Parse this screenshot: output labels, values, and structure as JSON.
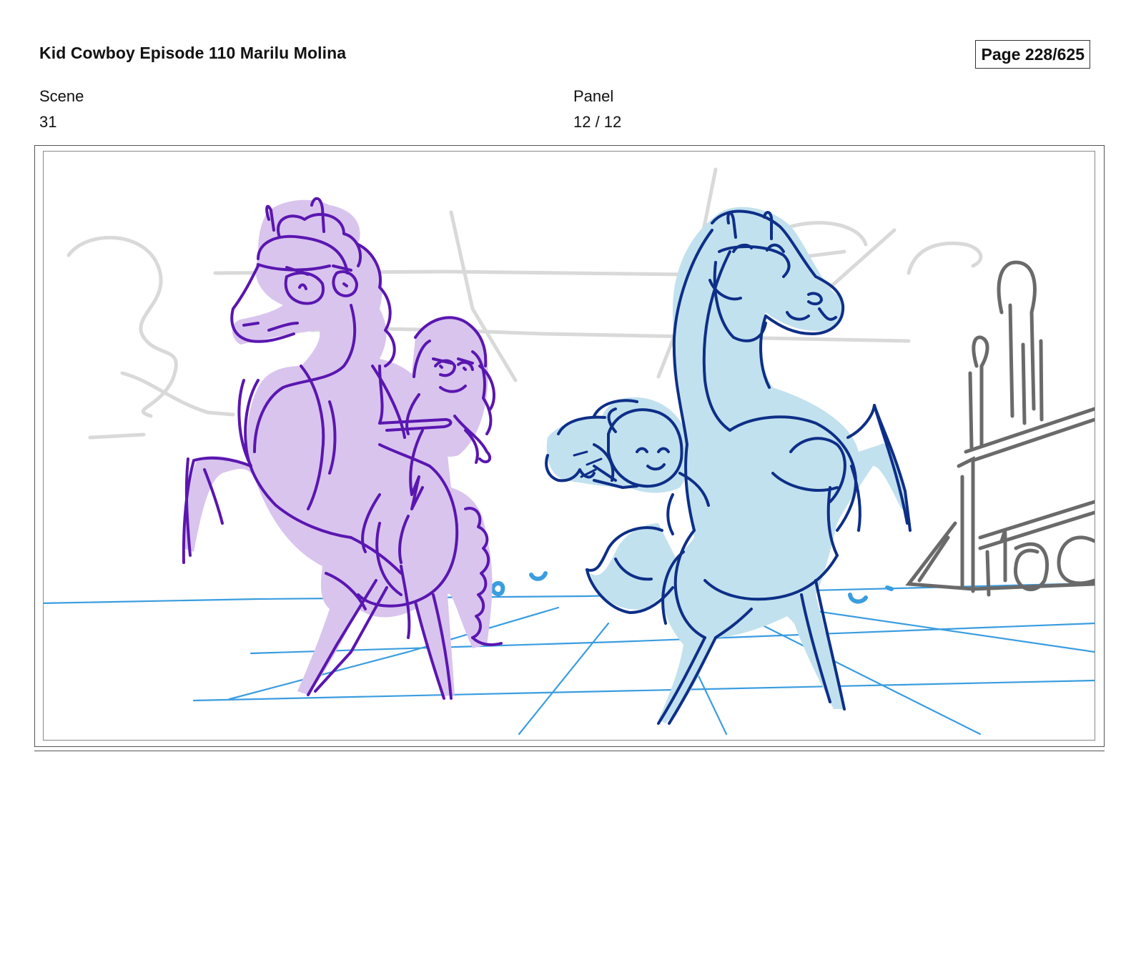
{
  "header": {
    "title": "Kid Cowboy Episode 110 Marilu Molina",
    "page": "Page 228/625"
  },
  "scene": {
    "label": "Scene",
    "value": "31"
  },
  "panel": {
    "label": "Panel",
    "value": "12 / 12"
  },
  "drawing": {
    "colors": {
      "left_horse_fill": "#d9c4ee",
      "left_horse_line": "#5a16b0",
      "right_horse_fill": "#c2e1ee",
      "right_horse_line": "#0d2f87",
      "floor_grid": "#3a9de0",
      "background_sketch": "#d9d9d9",
      "prop_sketch": "#6a6a6a"
    }
  }
}
